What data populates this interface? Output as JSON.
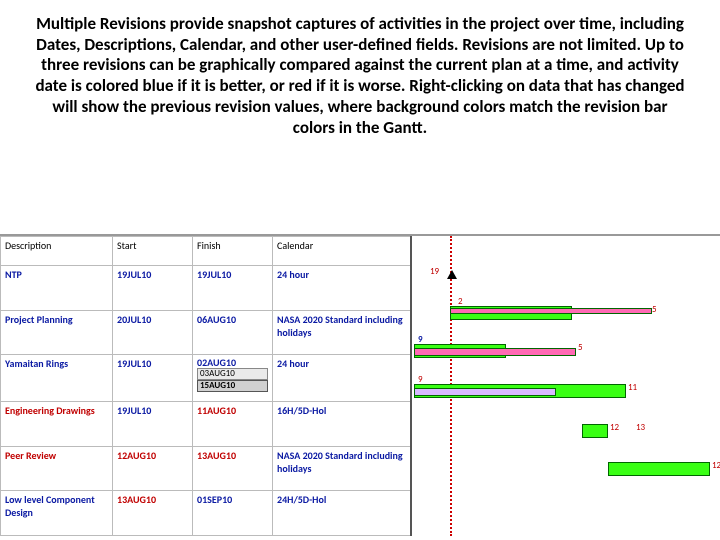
{
  "description": "Multiple Revisions provide snapshot captures of activities in the project over time, including Dates, Descriptions, Calendar, and other user-defined fields.  Revisions are not limited. Up to three revisions can be graphically compared against the current plan at a time, and activity date is colored blue if it is better, or red if it is worse.  Right-clicking on data that has changed will show the previous revision values, where background colors match the revision bar colors in the Gantt.",
  "columns": {
    "c1": "Description",
    "c2": "Start",
    "c3": "Finish",
    "c4": "Calendar"
  },
  "rows": [
    {
      "desc": "NTP",
      "start": "19JUL10",
      "finish": "19JUL10",
      "cal": "24 hour",
      "srev": [],
      "frev": []
    },
    {
      "desc": "Project Planning",
      "start": "20JUL10",
      "finish": "06AUG10",
      "cal": "NASA 2020 Standard including holidays",
      "srev": [],
      "frev": []
    },
    {
      "desc": "Yamaitan Rings",
      "start": "19JUL10",
      "finish": "02AUG10",
      "cal": "24 hour",
      "srev": [],
      "frev": [
        "03AUG10",
        "15AUG10"
      ]
    },
    {
      "desc": "Engineering Drawings",
      "start": "19JUL10",
      "finish": "11AUG10",
      "cal": "16H/5D-Hol",
      "srev": [],
      "frev": []
    },
    {
      "desc": "Peer Review",
      "start": "12AUG10",
      "finish": "13AUG10",
      "cal": "NASA 2020 Standard including holidays",
      "srev": [],
      "frev": []
    },
    {
      "desc": "Low level Component Design",
      "start": "13AUG10",
      "finish": "01SEP10",
      "cal": "24H/5D-Hol",
      "srev": [],
      "frev": []
    }
  ],
  "gantt_labels": {
    "m1": "19",
    "m2": "2",
    "m3": "5",
    "m4": "9",
    "m5": "9",
    "m6": "11",
    "m7": "12",
    "m8": "13",
    "m9": "12"
  }
}
